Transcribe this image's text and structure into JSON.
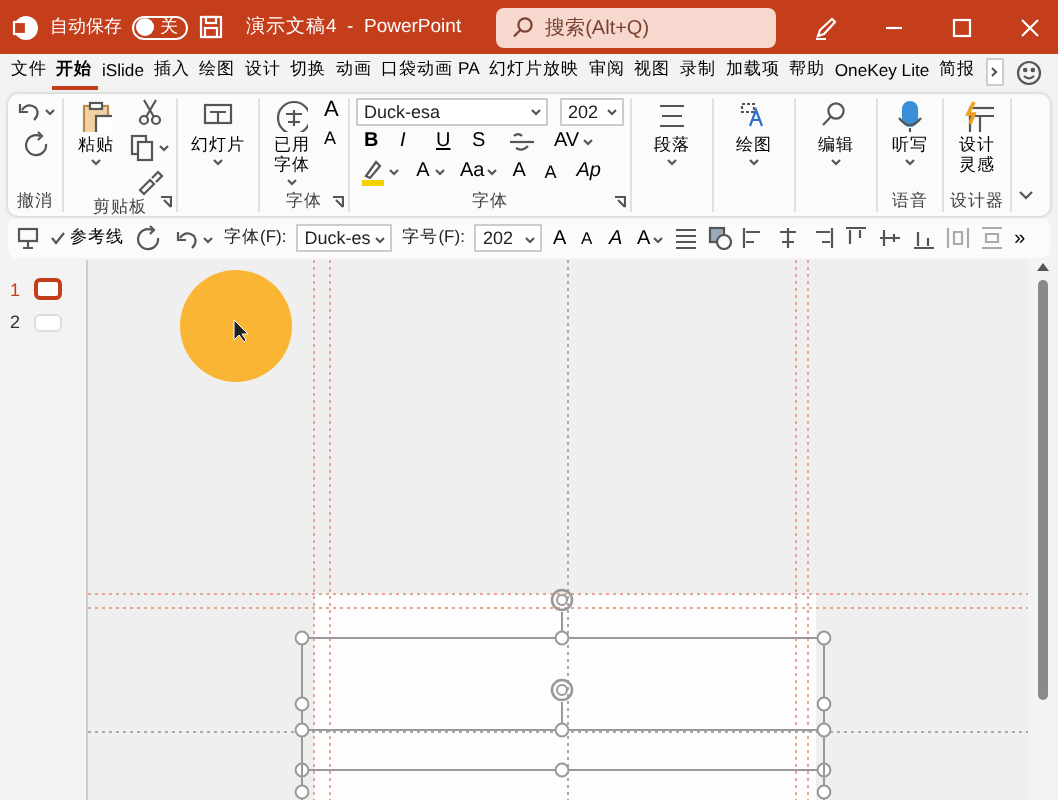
{
  "title_bar": {
    "autosave_label": "自动保存",
    "autosave_on": false,
    "toggle_text": "关",
    "title": "演示文稿4  -  PowerPoint",
    "search_placeholder": "搜索(Alt+Q)"
  },
  "tabs": [
    {
      "label": "文件",
      "selected": false
    },
    {
      "label": "开始",
      "selected": true
    },
    {
      "label": "iSlide",
      "selected": false
    },
    {
      "label": "插入",
      "selected": false
    },
    {
      "label": "绘图",
      "selected": false
    },
    {
      "label": "设计",
      "selected": false
    },
    {
      "label": "切换",
      "selected": false
    },
    {
      "label": "动画",
      "selected": false
    },
    {
      "label": "口袋动画 PA",
      "selected": false
    },
    {
      "label": "幻灯片放映",
      "selected": false
    },
    {
      "label": "审阅",
      "selected": false
    },
    {
      "label": "视图",
      "selected": false
    },
    {
      "label": "录制",
      "selected": false
    },
    {
      "label": "加载项",
      "selected": false
    },
    {
      "label": "帮助",
      "selected": false
    },
    {
      "label": "OneKey Lite",
      "selected": false
    },
    {
      "label": "简报",
      "selected": false
    }
  ],
  "ribbon": {
    "groups": [
      {
        "kind": "undo",
        "label": "撤消"
      },
      {
        "kind": "clipboard",
        "label": "剪贴板",
        "button": "粘贴"
      },
      {
        "kind": "large",
        "button": "幻灯片"
      },
      {
        "kind": "fontset",
        "label": "字体",
        "button": "已用字体",
        "letters": [
          "A",
          "A"
        ]
      },
      {
        "kind": "font",
        "label": "字体",
        "font": "Duck-esa",
        "size": "202",
        "styles": [
          "B",
          "I",
          "U",
          "S"
        ],
        "spacing": "AV",
        "color_letter": "A",
        "case": "Aa",
        "sizes": [
          "A",
          "A",
          "Ap"
        ]
      },
      {
        "kind": "large",
        "button": "段落"
      },
      {
        "kind": "large",
        "button": "绘图"
      },
      {
        "kind": "large",
        "button": "编辑"
      },
      {
        "kind": "voice",
        "label": "语音",
        "button": "听写"
      },
      {
        "kind": "design",
        "label": "设计器",
        "button": "设计灵感"
      }
    ]
  },
  "quick_toolbar": {
    "guides_label": "参考线",
    "guides_checked": true,
    "font_label": "字体(F):",
    "font": "Duck-es",
    "size_label": "字号(F):",
    "size": "202",
    "letters": [
      "A",
      "A",
      "A",
      "A"
    ],
    "more": "»"
  },
  "slides": [
    {
      "number": "1",
      "selected": true
    },
    {
      "number": "2",
      "selected": false
    }
  ]
}
